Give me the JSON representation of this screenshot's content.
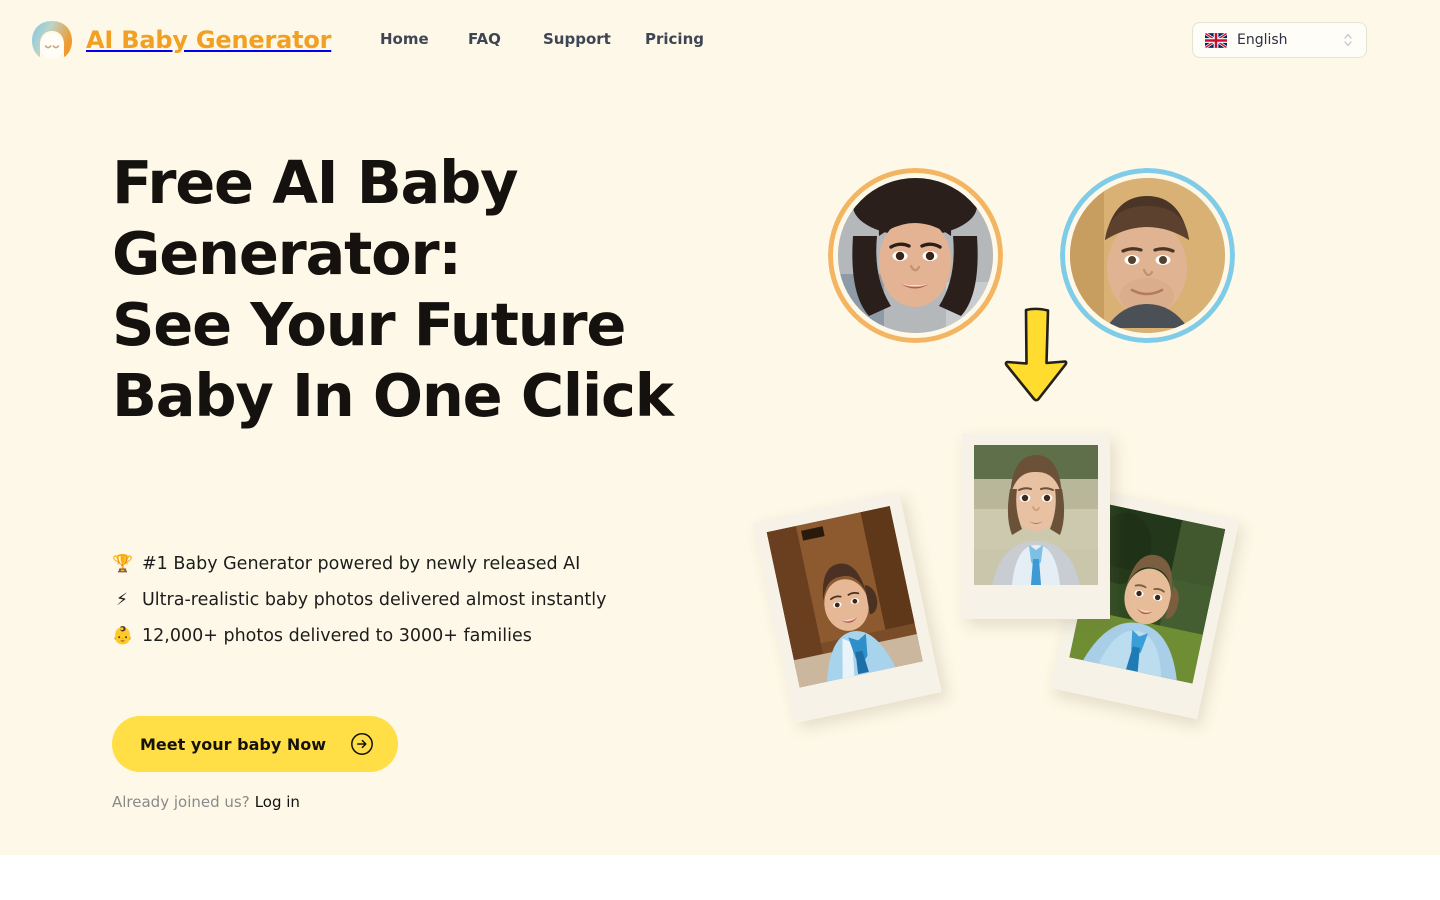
{
  "brand": {
    "name": "AI Baby Generator",
    "logo_icon": "baby-face-logo",
    "color": "#F2A023"
  },
  "nav": {
    "items": [
      {
        "label": "Home",
        "name": "home"
      },
      {
        "label": "FAQ",
        "name": "faq"
      },
      {
        "label": "Support",
        "name": "support"
      },
      {
        "label": "Pricing",
        "name": "pricing"
      }
    ]
  },
  "language_selector": {
    "value": "English",
    "flag": "uk-flag-icon",
    "chevron_icon": "chevron-up-down-icon"
  },
  "hero": {
    "headline": "Free AI Baby Generator:\nSee Your Future Baby In One Click",
    "bullets": [
      {
        "emoji": "🏆",
        "text": "#1 Baby Generator powered by newly released AI"
      },
      {
        "emoji": "⚡",
        "text": "Ultra-realistic baby photos delivered almost instantly"
      },
      {
        "emoji": "👶",
        "text": "12,000+ photos delivered to 3000+ families"
      }
    ],
    "cta": {
      "label": "Meet your baby Now",
      "icon": "arrow-right-circle-icon",
      "color": "#FFDE46"
    },
    "login": {
      "prefix": "Already joined us?",
      "link_label": "Log in"
    }
  },
  "visual": {
    "mother_avatar": {
      "name": "mother-avatar",
      "ring_color": "#F3B562"
    },
    "father_avatar": {
      "name": "father-avatar",
      "ring_color": "#7FCCE8"
    },
    "arrow_icon": "arrow-down-icon",
    "arrow_color": "#FFDC2D",
    "baby_photos": [
      {
        "name": "baby-photo-left",
        "rotation": "-12deg"
      },
      {
        "name": "baby-photo-center",
        "rotation": "0deg"
      },
      {
        "name": "baby-photo-right",
        "rotation": "12deg"
      }
    ]
  },
  "theme": {
    "background": "#FDF8E7",
    "page_background": "#FFFFFF",
    "text": "#14110E",
    "muted_text": "#8A8A8A",
    "nav_text": "#3E4655"
  }
}
